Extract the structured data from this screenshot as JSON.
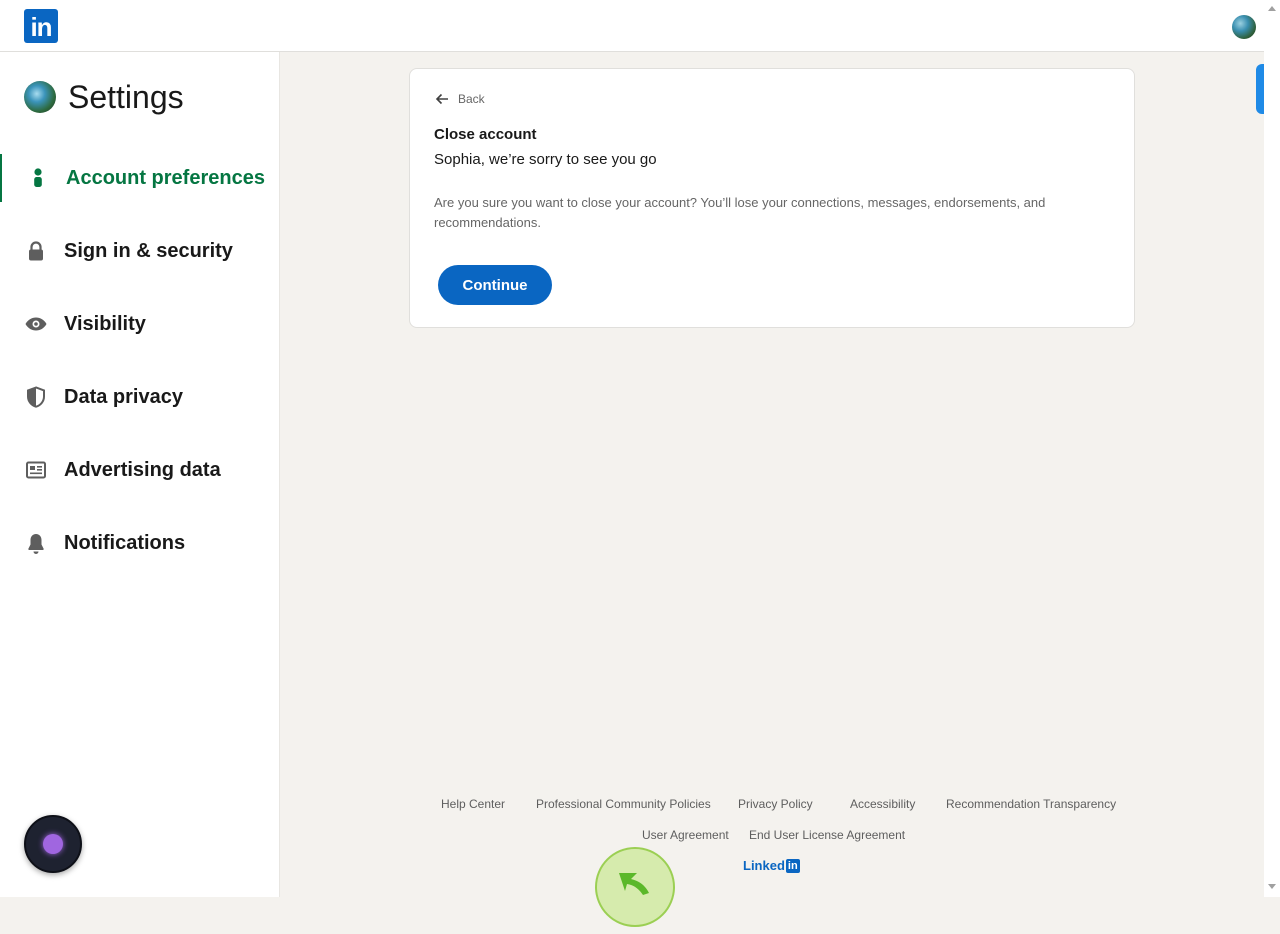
{
  "topbar": {
    "logo_text": "in",
    "logo_icon": "linkedin-logo",
    "profile_icon": "avatar"
  },
  "sidebar": {
    "title": "Settings",
    "items": [
      {
        "label": "Account preferences",
        "icon": "person-icon",
        "active": true
      },
      {
        "label": "Sign in & security",
        "icon": "lock-icon",
        "active": false
      },
      {
        "label": "Visibility",
        "icon": "eye-icon",
        "active": false
      },
      {
        "label": "Data privacy",
        "icon": "shield-icon",
        "active": false
      },
      {
        "label": "Advertising data",
        "icon": "newspaper-icon",
        "active": false
      },
      {
        "label": "Notifications",
        "icon": "bell-icon",
        "active": false
      }
    ]
  },
  "card": {
    "back_label": "Back",
    "title": "Close account",
    "subtitle": "Sophia, we’re sorry to see you go",
    "body": "Are you sure you want to close your account? You’ll lose your connections, messages, endorsements, and recommendations.",
    "continue_label": "Continue"
  },
  "footer": {
    "links": [
      "Help Center",
      "Professional Community Policies",
      "Privacy Policy",
      "Accessibility",
      "Recommendation Transparency",
      "User Agreement",
      "End User License Agreement"
    ],
    "brand_text": "Linked",
    "brand_box": "in"
  },
  "colors": {
    "brand_blue": "#0a66c2",
    "active_green": "#057642",
    "page_bg": "#f4f2ee"
  }
}
